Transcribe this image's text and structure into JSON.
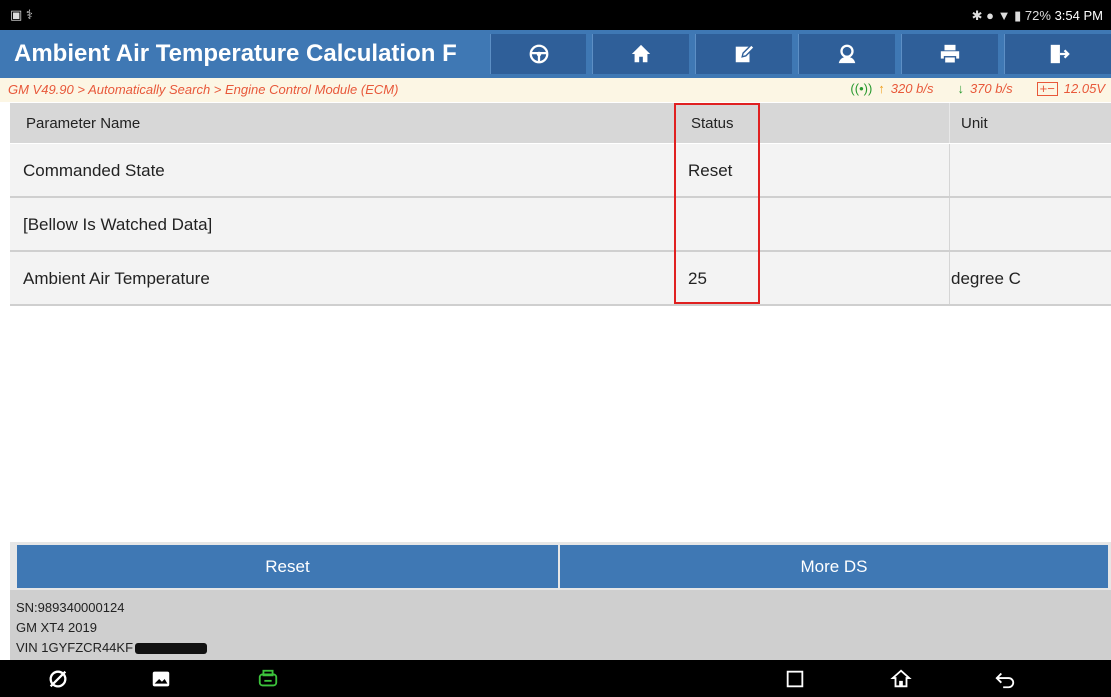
{
  "status_bar": {
    "left_icons": "▣ ⚕",
    "battery": "72%",
    "time": "3:54 PM"
  },
  "header": {
    "title": "Ambient Air Temperature Calculation F",
    "toolbar": [
      {
        "icon": "steering-wheel-icon"
      },
      {
        "icon": "home-icon"
      },
      {
        "icon": "edit-icon"
      },
      {
        "icon": "support-icon"
      },
      {
        "icon": "print-icon"
      },
      {
        "icon": "exit-icon"
      }
    ]
  },
  "breadcrumb": "GM V49.90 > Automatically Search > Engine Control Module (ECM)",
  "network": {
    "upload": "320 b/s",
    "download": "370 b/s",
    "voltage": "12.05V"
  },
  "table": {
    "headers": {
      "name": "Parameter Name",
      "status": "Status",
      "unit": "Unit"
    },
    "rows": [
      {
        "name": "Commanded State",
        "status": "Reset",
        "unit": ""
      },
      {
        "name": "[Bellow Is Watched Data]",
        "status": "",
        "unit": ""
      },
      {
        "name": "Ambient Air Temperature",
        "status": "25",
        "unit": "degree C"
      }
    ]
  },
  "buttons": {
    "reset": "Reset",
    "more_ds": "More DS"
  },
  "footer": {
    "sn": "SN:989340000124",
    "vehicle": "GM XT4 2019",
    "vin": "VIN 1GYFZCR44KF"
  },
  "colors": {
    "header": "#3f78b4",
    "breadcrumb_text": "#e8583a",
    "highlight": "#e02020"
  }
}
